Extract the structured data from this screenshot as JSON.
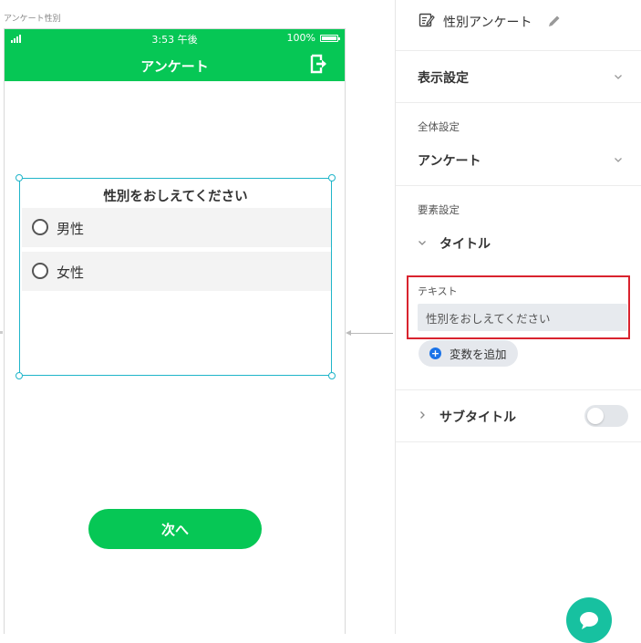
{
  "canvas": {
    "frame_label": "アンケート性別",
    "status_bar": {
      "time": "3:53 午後",
      "battery": "100%"
    },
    "navbar": {
      "title": "アンケート",
      "right_icon": "logout-icon"
    },
    "question": {
      "title": "性別をおしえてください",
      "options": [
        {
          "label": "男性",
          "selected": false
        },
        {
          "label": "女性",
          "selected": false
        }
      ]
    },
    "next_button": "次へ"
  },
  "panel": {
    "header": {
      "title": "性別アンケート",
      "icon": "edit-note-icon",
      "edit_icon": "pencil-icon"
    },
    "display_settings": {
      "label": "表示設定"
    },
    "global_settings": {
      "heading": "全体設定",
      "value": "アンケート"
    },
    "element_settings": {
      "heading": "要素設定",
      "title_section": {
        "label": "タイトル",
        "expanded": true
      },
      "text_field": {
        "label": "テキスト",
        "value": "性別をおしえてください"
      },
      "add_variable_button": "変数を追加",
      "subtitle_section": {
        "label": "サブタイトル",
        "enabled": false
      }
    },
    "chat_button": {
      "icon": "chat-bubble-icon"
    }
  },
  "colors": {
    "brand_green": "#06c755",
    "selection_outline": "#1fb5c9",
    "highlight_red": "#d9232e",
    "chat_teal": "#17c1a0",
    "accent_blue": "#1a73e8"
  }
}
